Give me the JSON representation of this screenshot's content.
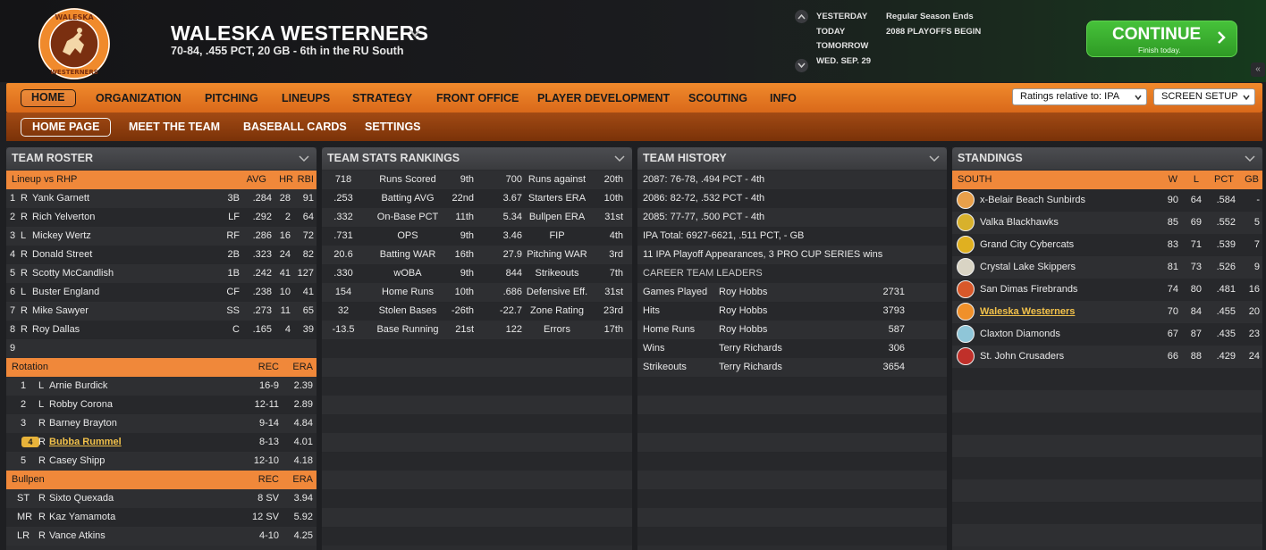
{
  "header": {
    "team_name": "WALESKA WESTERNERS",
    "record": "70-84, .455 PCT, 20 GB - 6th in the RU South",
    "dates": [
      "YESTERDAY",
      "TODAY",
      "TOMORROW",
      "WED. SEP. 29"
    ],
    "events": [
      "Regular Season Ends",
      "2088 PLAYOFFS BEGIN"
    ],
    "continue_label": "CONTINUE",
    "continue_sub": "Finish today.",
    "logo_top": "WALESKA",
    "logo_bottom": "WESTERNERS"
  },
  "menu": {
    "items": [
      "HOME",
      "ORGANIZATION",
      "PITCHING",
      "LINEUPS",
      "STRATEGY",
      "FRONT OFFICE",
      "PLAYER DEVELOPMENT",
      "SCOUTING",
      "INFO"
    ],
    "ratings_select": "Ratings relative to: IPA",
    "screen_setup": "SCREEN SETUP"
  },
  "submenu": {
    "items": [
      "HOME PAGE",
      "MEET THE TEAM",
      "BASEBALL CARDS",
      "SETTINGS"
    ]
  },
  "roster": {
    "title": "TEAM ROSTER",
    "lineup_header": {
      "label": "Lineup vs RHP",
      "avg": "AVG",
      "hr": "HR",
      "rbi": "RBI"
    },
    "lineup": [
      {
        "n": "1",
        "hand": "R",
        "name": "Yank Garnett",
        "pos": "3B",
        "avg": ".284",
        "hr": "28",
        "rbi": "91"
      },
      {
        "n": "2",
        "hand": "R",
        "name": "Rich Yelverton",
        "pos": "LF",
        "avg": ".292",
        "hr": "2",
        "rbi": "64"
      },
      {
        "n": "3",
        "hand": "L",
        "name": "Mickey Wertz",
        "pos": "RF",
        "avg": ".286",
        "hr": "16",
        "rbi": "72"
      },
      {
        "n": "4",
        "hand": "R",
        "name": "Donald Street",
        "pos": "2B",
        "avg": ".323",
        "hr": "24",
        "rbi": "82"
      },
      {
        "n": "5",
        "hand": "R",
        "name": "Scotty McCandlish",
        "pos": "1B",
        "avg": ".242",
        "hr": "41",
        "rbi": "127"
      },
      {
        "n": "6",
        "hand": "L",
        "name": "Buster England",
        "pos": "CF",
        "avg": ".238",
        "hr": "10",
        "rbi": "41"
      },
      {
        "n": "7",
        "hand": "R",
        "name": "Mike Sawyer",
        "pos": "SS",
        "avg": ".273",
        "hr": "11",
        "rbi": "65"
      },
      {
        "n": "8",
        "hand": "R",
        "name": "Roy Dallas",
        "pos": "C",
        "avg": ".165",
        "hr": "4",
        "rbi": "39"
      },
      {
        "n": "9",
        "hand": "",
        "name": "",
        "pos": "",
        "avg": "",
        "hr": "",
        "rbi": ""
      }
    ],
    "rotation_header": {
      "label": "Rotation",
      "rec": "REC",
      "era": "ERA"
    },
    "rotation": [
      {
        "n": "1",
        "hand": "L",
        "name": "Arnie Burdick",
        "rec": "16-9",
        "era": "2.39",
        "highlight": false
      },
      {
        "n": "2",
        "hand": "L",
        "name": "Robby Corona",
        "rec": "12-11",
        "era": "2.89",
        "highlight": false
      },
      {
        "n": "3",
        "hand": "R",
        "name": "Barney Brayton",
        "rec": "9-14",
        "era": "4.84",
        "highlight": false
      },
      {
        "n": "4",
        "hand": "R",
        "name": "Bubba Rummel",
        "rec": "8-13",
        "era": "4.01",
        "highlight": true
      },
      {
        "n": "5",
        "hand": "R",
        "name": "Casey Shipp",
        "rec": "12-10",
        "era": "4.18",
        "highlight": false
      }
    ],
    "bullpen_header": {
      "label": "Bullpen",
      "rec": "REC",
      "era": "ERA"
    },
    "bullpen": [
      {
        "role": "ST",
        "hand": "R",
        "name": "Sixto Quexada",
        "rec": "8 SV",
        "era": "3.94"
      },
      {
        "role": "MR",
        "hand": "R",
        "name": "Kaz Yamamota",
        "rec": "12 SV",
        "era": "5.92"
      },
      {
        "role": "LR",
        "hand": "R",
        "name": "Vance Atkins",
        "rec": "4-10",
        "era": "4.25"
      }
    ]
  },
  "stats": {
    "title": "TEAM STATS RANKINGS",
    "rows": [
      {
        "v1": "718",
        "l1": "Runs Scored",
        "r1": "9th",
        "v2": "700",
        "l2": "Runs against",
        "r2": "20th"
      },
      {
        "v1": ".253",
        "l1": "Batting AVG",
        "r1": "22nd",
        "v2": "3.67",
        "l2": "Starters ERA",
        "r2": "10th"
      },
      {
        "v1": ".332",
        "l1": "On-Base PCT",
        "r1": "11th",
        "v2": "5.34",
        "l2": "Bullpen ERA",
        "r2": "31st"
      },
      {
        "v1": ".731",
        "l1": "OPS",
        "r1": "9th",
        "v2": "3.46",
        "l2": "FIP",
        "r2": "4th"
      },
      {
        "v1": "20.6",
        "l1": "Batting WAR",
        "r1": "16th",
        "v2": "27.9",
        "l2": "Pitching WAR",
        "r2": "3rd"
      },
      {
        "v1": ".330",
        "l1": "wOBA",
        "r1": "9th",
        "v2": "844",
        "l2": "Strikeouts",
        "r2": "7th"
      },
      {
        "v1": "154",
        "l1": "Home Runs",
        "r1": "10th",
        "v2": ".686",
        "l2": "Defensive Eff.",
        "r2": "31st"
      },
      {
        "v1": "32",
        "l1": "Stolen Bases",
        "r1": "-26th",
        "v2": "-22.7",
        "l2": "Zone Rating",
        "r2": "23rd"
      },
      {
        "v1": "-13.5",
        "l1": "Base Running",
        "r1": "21st",
        "v2": "122",
        "l2": "Errors",
        "r2": "17th"
      }
    ]
  },
  "history": {
    "title": "TEAM HISTORY",
    "lines": [
      "2087: 76-78, .494 PCT - 4th",
      "2086: 82-72, .532 PCT - 4th",
      "2085: 77-77, .500 PCT - 4th",
      "IPA Total: 6927-6621, .511 PCT, - GB",
      "11 IPA Playoff Appearances, 3 PRO CUP SERIES wins"
    ],
    "leaders_title": "CAREER TEAM LEADERS",
    "leaders": [
      {
        "stat": "Games Played",
        "name": "Roy Hobbs",
        "value": "2731"
      },
      {
        "stat": "Hits",
        "name": "Roy Hobbs",
        "value": "3793"
      },
      {
        "stat": "Home Runs",
        "name": "Roy Hobbs",
        "value": "587"
      },
      {
        "stat": "Wins",
        "name": "Terry Richards",
        "value": "306"
      },
      {
        "stat": "Strikeouts",
        "name": "Terry Richards",
        "value": "3654"
      }
    ]
  },
  "standings": {
    "title": "STANDINGS",
    "header": {
      "div": "SOUTH",
      "w": "W",
      "l": "L",
      "pct": "PCT",
      "gb": "GB"
    },
    "teams": [
      {
        "name": "x-Belair Beach Sunbirds",
        "w": "90",
        "l": "64",
        "pct": ".584",
        "gb": "-",
        "icon": "sunbird-icon",
        "color": "#e9a04a",
        "highlight": false
      },
      {
        "name": "Valka Blackhawks",
        "w": "85",
        "l": "69",
        "pct": ".552",
        "gb": "5",
        "icon": "blackhawk-icon",
        "color": "#d8b12c",
        "highlight": false
      },
      {
        "name": "Grand City Cybercats",
        "w": "83",
        "l": "71",
        "pct": ".539",
        "gb": "7",
        "icon": "cybercat-icon",
        "color": "#e0b020",
        "highlight": false
      },
      {
        "name": "Crystal Lake Skippers",
        "w": "81",
        "l": "73",
        "pct": ".526",
        "gb": "9",
        "icon": "skipper-icon",
        "color": "#d9d4c4",
        "highlight": false
      },
      {
        "name": "San Dimas Firebrands",
        "w": "74",
        "l": "80",
        "pct": ".481",
        "gb": "16",
        "icon": "firebrand-icon",
        "color": "#d8582a",
        "highlight": false
      },
      {
        "name": "Waleska Westerners",
        "w": "70",
        "l": "84",
        "pct": ".455",
        "gb": "20",
        "icon": "westerners-w-icon",
        "color": "#f0902a",
        "highlight": true
      },
      {
        "name": "Claxton Diamonds",
        "w": "67",
        "l": "87",
        "pct": ".435",
        "gb": "23",
        "icon": "diamond-icon",
        "color": "#8fc6d8",
        "highlight": false
      },
      {
        "name": "St. John Crusaders",
        "w": "66",
        "l": "88",
        "pct": ".429",
        "gb": "24",
        "icon": "crusader-icon",
        "color": "#c0302a",
        "highlight": false
      }
    ]
  }
}
